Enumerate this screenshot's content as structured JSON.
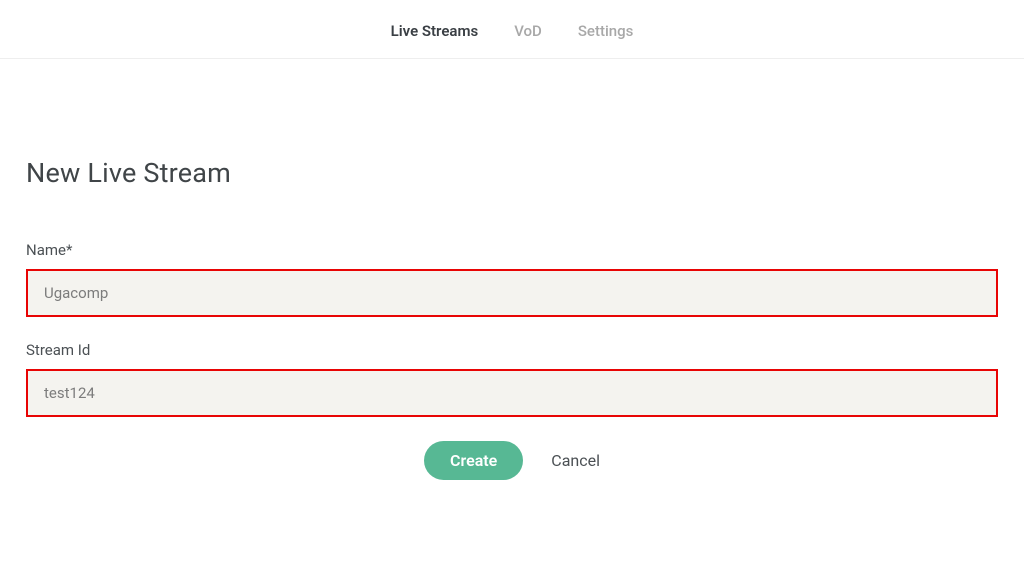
{
  "nav": {
    "items": [
      {
        "label": "Live Streams",
        "active": true
      },
      {
        "label": "VoD",
        "active": false
      },
      {
        "label": "Settings",
        "active": false
      }
    ]
  },
  "page": {
    "title": "New Live Stream"
  },
  "form": {
    "name": {
      "label": "Name*",
      "value": "Ugacomp"
    },
    "stream_id": {
      "label": "Stream Id",
      "value": "test124"
    }
  },
  "actions": {
    "create": "Create",
    "cancel": "Cancel"
  }
}
